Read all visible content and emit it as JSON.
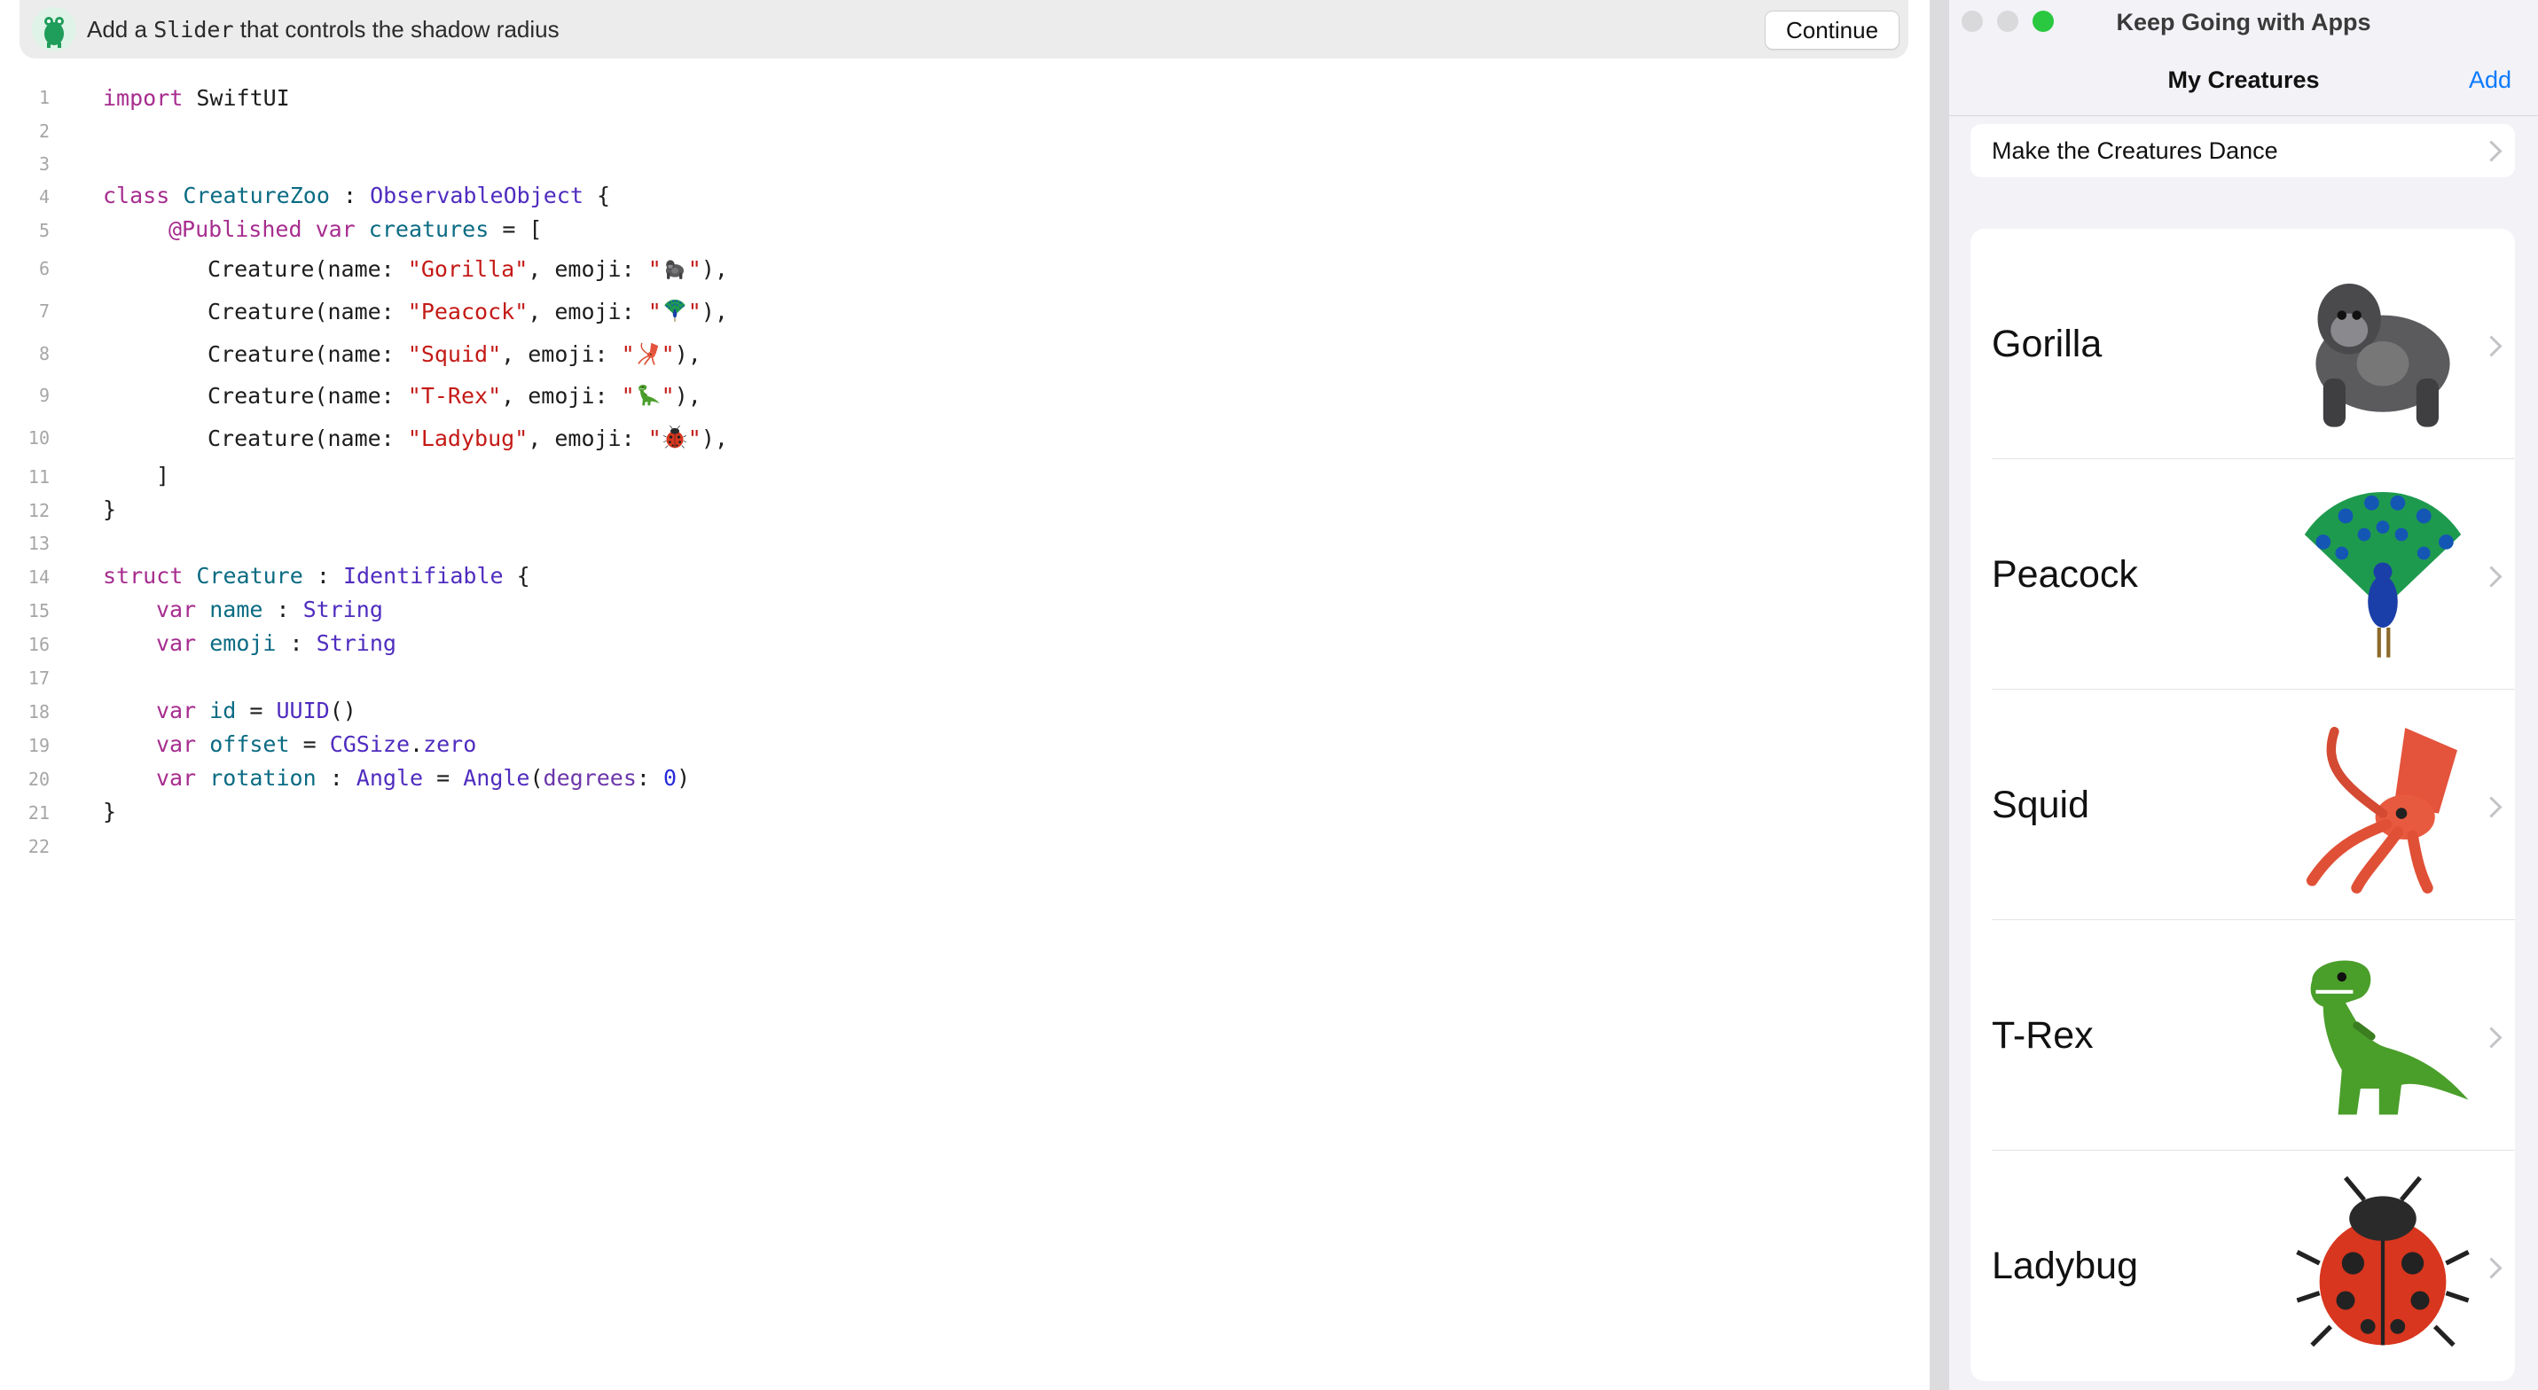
{
  "banner": {
    "text_before": "Add a",
    "code_word": "Slider",
    "text_after": "that controls the shadow radius",
    "continue_label": "Continue"
  },
  "code": {
    "line_numbers": [
      "1",
      "2",
      "3",
      "4",
      "5",
      "6",
      "7",
      "8",
      "9",
      "10",
      "11",
      "12",
      "13",
      "14",
      "15",
      "16",
      "17",
      "18",
      "19",
      "20",
      "21",
      "22"
    ]
  },
  "window": {
    "title": "Keep Going with Apps"
  },
  "nav": {
    "title": "My Creatures",
    "add_label": "Add"
  },
  "dance": {
    "label": "Make the Creatures Dance"
  },
  "creatures": [
    {
      "name": "Gorilla",
      "icon": "gorilla-emoji"
    },
    {
      "name": "Peacock",
      "icon": "peacock-emoji"
    },
    {
      "name": "Squid",
      "icon": "squid-emoji"
    },
    {
      "name": "T-Rex",
      "icon": "t-rex-emoji"
    },
    {
      "name": "Ladybug",
      "icon": "ladybug-emoji"
    }
  ],
  "colors": {
    "keyword": "#a72d8f",
    "type": "#4f2cbf",
    "identifier": "#0b6b83",
    "string": "#c41a16",
    "number": "#272ad8",
    "accent": "#0a7aff",
    "traffic_close": "#d9d9db",
    "traffic_min": "#d9d9db",
    "traffic_zoom": "#2ac840"
  }
}
